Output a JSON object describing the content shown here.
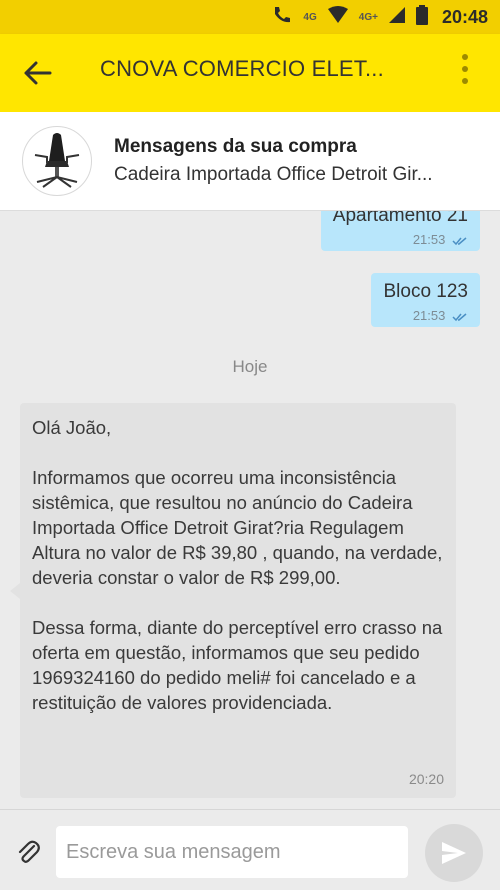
{
  "status_bar": {
    "network_label": "4G",
    "network_label_2": "4G+",
    "time": "20:48"
  },
  "app_bar": {
    "title": "CNOVA COMERCIO ELET..."
  },
  "conversation": {
    "title": "Mensagens da sua compra",
    "product_name": "Cadeira Importada Office Detroit Gir..."
  },
  "messages": {
    "out": [
      {
        "text": "Apartamento 21",
        "time": "21:53"
      },
      {
        "text": "Bloco 123",
        "time": "21:53"
      }
    ],
    "day_separator": "Hoje",
    "in": {
      "greeting": "Olá João,",
      "paragraph1": "Informamos que ocorreu uma inconsistência sistêmica, que resultou no anúncio do Cadeira Importada Office Detroit Girat?ria Regulagem Altura no valor de R$ 39,80 , quando, na verdade, deveria constar o valor de R$ 299,00.",
      "paragraph2": "Dessa forma, diante do perceptível erro crasso na oferta em questão, informamos que seu pedido 1969324160 do pedido meli# foi cancelado e a restituição de valores providenciada.",
      "time": "20:20"
    }
  },
  "composer": {
    "placeholder": "Escreva sua mensagem"
  },
  "colors": {
    "brand_yellow": "#ffe600",
    "status_yellow": "#f2cf00",
    "outgoing_bubble": "#b8e6fb",
    "incoming_bubble": "#e2e2e2"
  }
}
